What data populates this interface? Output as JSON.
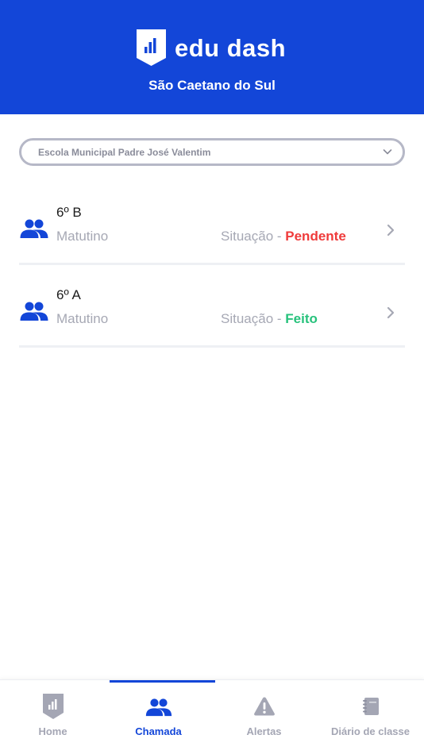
{
  "header": {
    "brand_name": "edu dash",
    "city": "São Caetano do Sul",
    "logo_icon": "edudash-chart-shield-icon"
  },
  "school_select": {
    "value": "Escola Municipal Padre José Valentim",
    "icon": "chevron-down-icon"
  },
  "classes": [
    {
      "name": "6º B",
      "shift": "Matutino",
      "status_label": "Situação - ",
      "status": "Pendente",
      "status_color": "#ef3b3b",
      "icon": "people-icon"
    },
    {
      "name": "6º A",
      "shift": "Matutino",
      "status_label": "Situação - ",
      "status": "Feito",
      "status_color": "#27c27c",
      "icon": "people-icon"
    }
  ],
  "bottom_nav": {
    "active": "Chamada",
    "items": [
      {
        "label": "Home",
        "icon": "home-chart-icon"
      },
      {
        "label": "Chamada",
        "icon": "people-icon"
      },
      {
        "label": "Alertas",
        "icon": "warning-icon"
      },
      {
        "label": "Diário de classe",
        "icon": "notebook-icon"
      }
    ]
  },
  "colors": {
    "brand_blue": "#1346d8",
    "pending_red": "#ef3b3b",
    "done_green": "#27c27c",
    "inactive_gray": "#a4a6b4"
  }
}
